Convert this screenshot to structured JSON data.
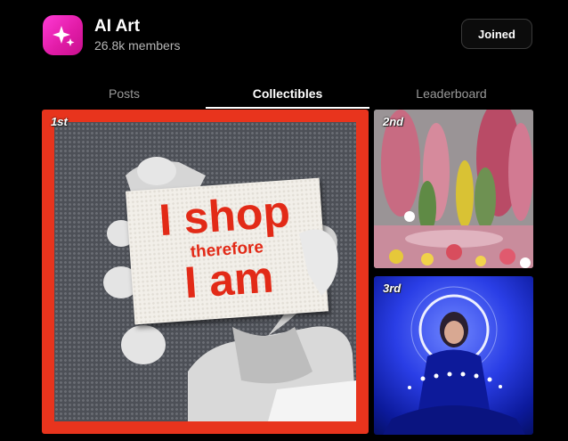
{
  "community": {
    "name": "AI Art",
    "members": "26.8k members",
    "joined_label": "Joined",
    "icon": "sparkles-icon",
    "accent": "#ff2fc8"
  },
  "tabs": [
    {
      "label": "Posts",
      "active": false
    },
    {
      "label": "Collectibles",
      "active": true
    },
    {
      "label": "Leaderboard",
      "active": false
    }
  ],
  "collectibles": [
    {
      "rank": "1st",
      "sign_text": [
        "I shop",
        "therefore",
        "I am"
      ]
    },
    {
      "rank": "2nd"
    },
    {
      "rank": "3rd"
    }
  ]
}
